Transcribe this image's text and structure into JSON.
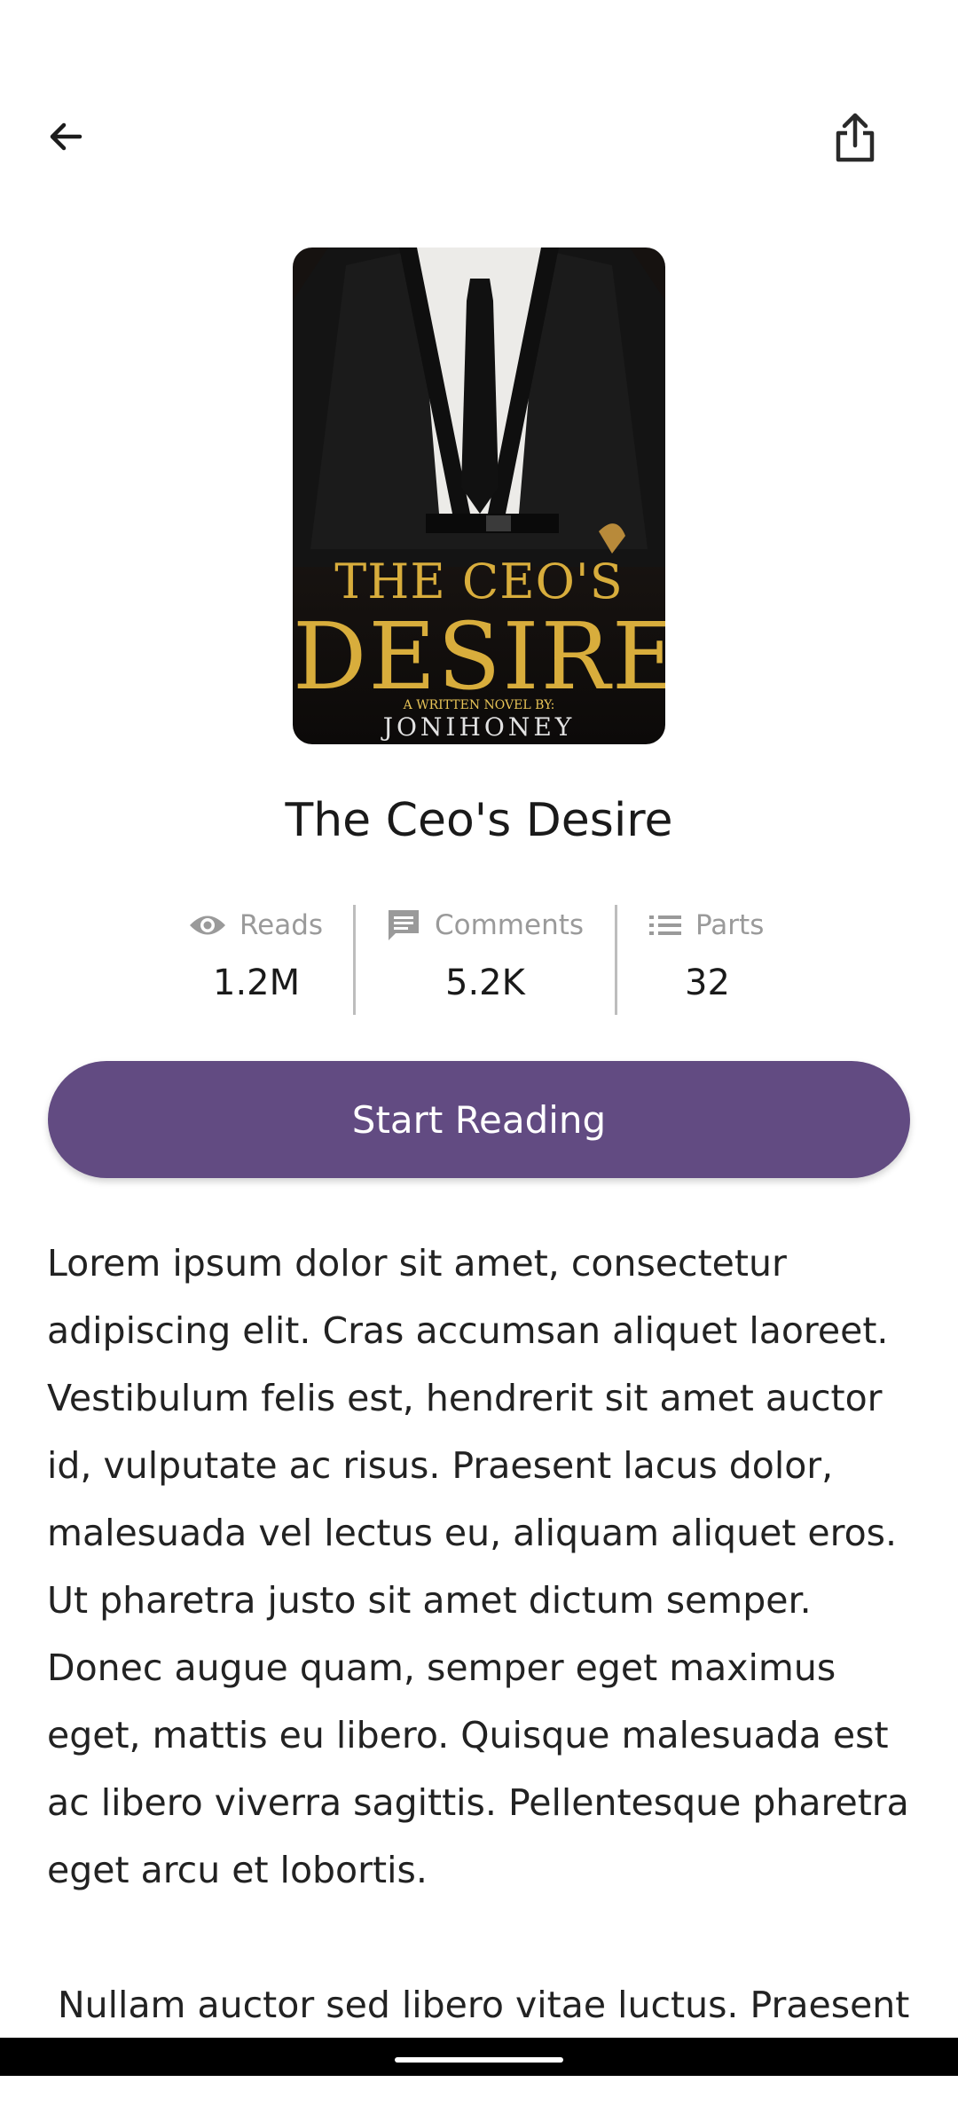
{
  "book": {
    "title": "The Ceo's Desire",
    "cover": {
      "title_line1": "THE CEO'S",
      "title_line2": "DESIRE",
      "subtitle": "A WRITTEN NOVEL BY:",
      "author": "JONIHONEY"
    }
  },
  "stats": {
    "reads": {
      "label": "Reads",
      "value": "1.2M",
      "icon": "eye-icon"
    },
    "comments": {
      "label": "Comments",
      "value": "5.2K",
      "icon": "comment-icon"
    },
    "parts": {
      "label": "Parts",
      "value": "32",
      "icon": "list-icon"
    }
  },
  "actions": {
    "start_label": "Start Reading"
  },
  "description": {
    "p1": "Lorem ipsum dolor sit amet, consectetur adipiscing elit. Cras accumsan aliquet laoreet. Vestibulum felis est, hendrerit sit amet auctor id, vulputate ac risus. Praesent lacus dolor, malesuada vel lectus eu, aliquam aliquet eros. Ut pharetra justo sit amet dictum semper. Donec augue quam, semper eget maximus eget, mattis eu libero. Quisque malesuada est ac libero viverra sagittis. Pellentesque pharetra eget arcu et lobortis.",
    "p2": "Nullam auctor sed libero vitae luctus. Praesent"
  },
  "colors": {
    "accent": "#624b82",
    "muted_text": "#9a9a9a",
    "cover_gold": "#d8ad3c"
  },
  "icons": {
    "back": "arrow-left-icon",
    "share": "share-icon"
  }
}
